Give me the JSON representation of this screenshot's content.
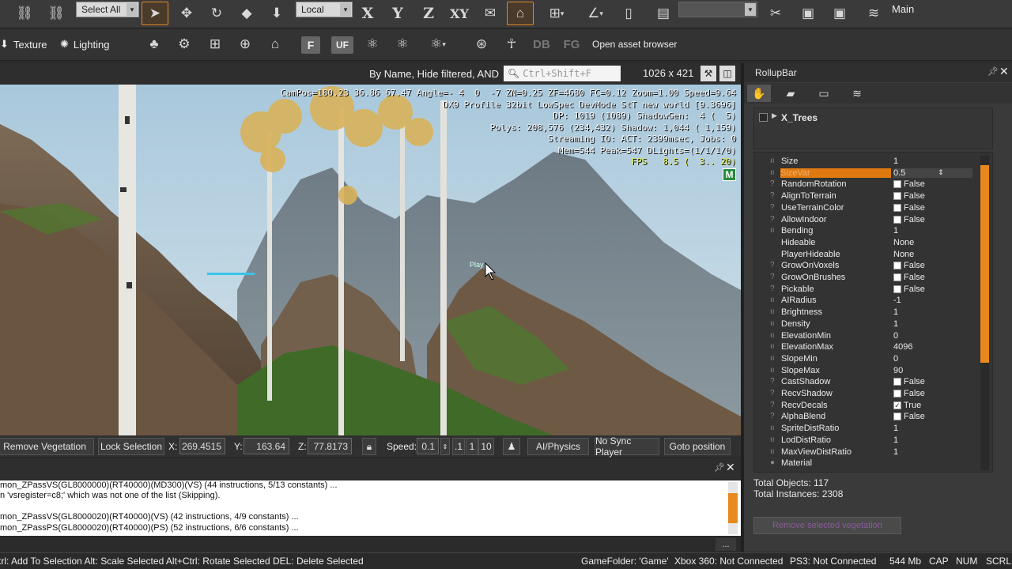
{
  "toolbar": {
    "select_filter": "Select All",
    "coord_system": "Local",
    "axes": [
      "X",
      "Y",
      "Z",
      "XY"
    ],
    "layer": "",
    "layout": "Main",
    "row2": {
      "texture": "Texture",
      "lighting": "Lighting",
      "f_btn": "F",
      "uf_btn": "UF",
      "db_btn": "DB",
      "fg_btn": "FG",
      "asset_browser": "Open asset browser"
    }
  },
  "viewport": {
    "filter_text": "By Name, Hide filtered, AND",
    "search_placeholder": "Ctrl+Shift+F",
    "resolution": "1026 x 421",
    "hud_lines": [
      "CamPos=180.23 36.86 67.47 Angle=- 4  0  -7 ZN=0.25 ZF=4680 FC=0.12 Zoom=1.00 Speed=9.64",
      "DX9 Profile 32bit LowSpec DevMode StT new world [9.3696]",
      "DP: 1019 (1089) ShadowGen:  4 (  5)",
      "Polys: 208,576 (234,432) Shadow: 1,044 ( 1,159)",
      "Streaming IO: ACT: 2399msec, Jobs: 0",
      "Mem=544 Peak=547 DLights=(1/1/1/0)"
    ],
    "fps_line": "FPS   8.5 (  3.. 20)",
    "m_badge": "M",
    "player_label": "Play"
  },
  "viewport_status": {
    "remove_vegetation": "Remove Vegetation",
    "lock_selection": "Lock Selection",
    "x_label": "X:",
    "x_value": "269.4515",
    "y_label": "Y:",
    "y_value": "163.64",
    "z_label": "Z:",
    "z_value": "77.8173",
    "speed_label": "Speed:",
    "speed_value": "0.1",
    "speed_presets": [
      ".1",
      "1",
      "10"
    ],
    "ai_physics": "AI/Physics",
    "no_sync_player": "No Sync Player",
    "goto_position": "Goto position"
  },
  "console": {
    "lines": [
      "mon_ZPassVS(GL8000000)(RT40000)(MD300)(VS) (44 instructions, 5/13 constants) ...",
      "n 'vsregister=c8;' which was not one of the list (Skipping).",
      "",
      "mon_ZPassVS(GL8000020)(RT40000)(VS) (42 instructions, 4/9 constants) ...",
      "mon_ZPassPS(GL8000020)(RT40000)(PS) (52 instructions, 6/6 constants) ..."
    ],
    "more_button": "..."
  },
  "statusbar": {
    "hint": "trl: Add To Selection  Alt: Scale Selected  Alt+Ctrl: Rotate Selected DEL: Delete Selected",
    "game_folder": "GameFolder: 'Game'",
    "xbox": "Xbox 360: Not Connected",
    "ps3": "PS3: Not Connected",
    "memory": "544 Mb",
    "caps": "CAP",
    "num": "NUM",
    "scroll": "SCRL"
  },
  "rollupbar": {
    "title": "RollupBar",
    "group_name": "X_Trees",
    "properties": [
      {
        "mark": "ıı",
        "name": "Size",
        "value": "1"
      },
      {
        "mark": "ıı",
        "name": "SizeVar",
        "value": "0.5",
        "selected": true
      },
      {
        "mark": "?",
        "name": "RandomRotation",
        "check": "",
        "value": "False"
      },
      {
        "mark": "?",
        "name": "AlignToTerrain",
        "check": "",
        "value": "False"
      },
      {
        "mark": "?",
        "name": "UseTerrainColor",
        "check": "",
        "value": "False"
      },
      {
        "mark": "?",
        "name": "AllowIndoor",
        "check": "",
        "value": "False"
      },
      {
        "mark": "ıı",
        "name": "Bending",
        "value": "1"
      },
      {
        "mark": "",
        "name": "Hideable",
        "value": "None"
      },
      {
        "mark": "",
        "name": "PlayerHideable",
        "value": "None"
      },
      {
        "mark": "?",
        "name": "GrowOnVoxels",
        "check": "",
        "value": "False"
      },
      {
        "mark": "?",
        "name": "GrowOnBrushes",
        "check": "",
        "value": "False"
      },
      {
        "mark": "?",
        "name": "Pickable",
        "check": "",
        "value": "False"
      },
      {
        "mark": "ıı",
        "name": "AIRadius",
        "value": "-1"
      },
      {
        "mark": "ıı",
        "name": "Brightness",
        "value": "1"
      },
      {
        "mark": "ıı",
        "name": "Density",
        "value": "1"
      },
      {
        "mark": "ıı",
        "name": "ElevationMin",
        "value": "0"
      },
      {
        "mark": "ıı",
        "name": "ElevationMax",
        "value": "4096"
      },
      {
        "mark": "ıı",
        "name": "SlopeMin",
        "value": "0"
      },
      {
        "mark": "ıı",
        "name": "SlopeMax",
        "value": "90"
      },
      {
        "mark": "?",
        "name": "CastShadow",
        "check": "",
        "value": "False"
      },
      {
        "mark": "?",
        "name": "RecvShadow",
        "check": "",
        "value": "False"
      },
      {
        "mark": "?",
        "name": "RecvDecals",
        "check": "✓",
        "value": "True"
      },
      {
        "mark": "?",
        "name": "AlphaBlend",
        "check": "",
        "value": "False"
      },
      {
        "mark": "ıı",
        "name": "SpriteDistRatio",
        "value": "1"
      },
      {
        "mark": "ıı",
        "name": "LodDistRatio",
        "value": "1"
      },
      {
        "mark": "ıı",
        "name": "MaxViewDistRatio",
        "value": "1"
      },
      {
        "mark": "●",
        "name": "Material",
        "value": ""
      }
    ],
    "total_objects": "Total Objects: 117",
    "total_instances": "Total Instances: 2308",
    "bottom_button": "Remove selected vegetation"
  },
  "colors": {
    "accent": "#e8891f",
    "selected_row": "#e07a10",
    "fps": "#e8f040",
    "m_badge": "#2a8a3a"
  }
}
